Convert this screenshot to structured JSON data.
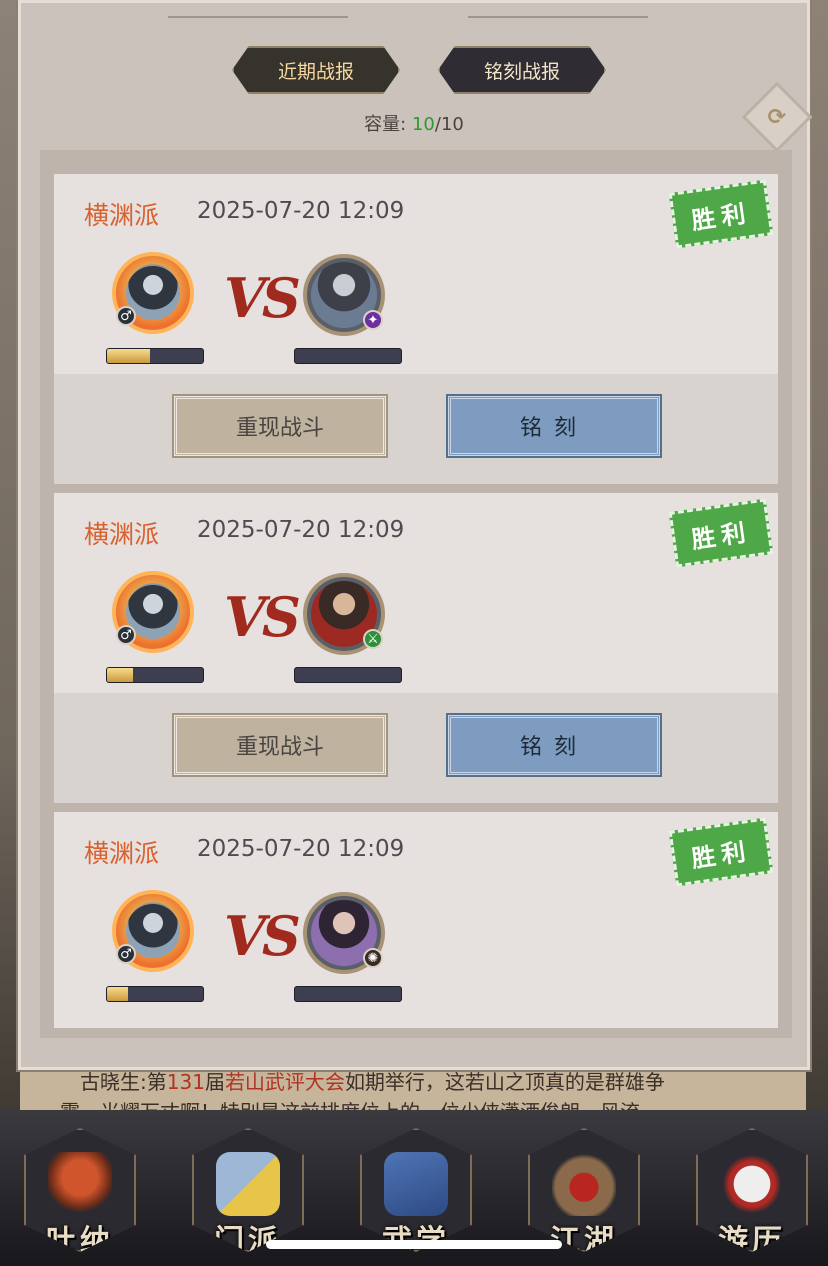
{
  "tabs": [
    {
      "label": "近期战报",
      "active": true
    },
    {
      "label": "铭刻战报",
      "active": false
    }
  ],
  "capacity": {
    "label": "容量:",
    "current": "10",
    "max": "/10"
  },
  "refresh_icon": "refresh-icon",
  "records": [
    {
      "sect": "横渊派",
      "time": "2025-07-20 12:09",
      "result": "胜利",
      "vs": "VS",
      "my_progress": 0.45,
      "replay_label": "重现战斗",
      "engrave_label": "铭刻"
    },
    {
      "sect": "横渊派",
      "time": "2025-07-20 12:09",
      "result": "胜利",
      "vs": "VS",
      "my_progress": 0.27,
      "replay_label": "重现战斗",
      "engrave_label": "铭刻"
    },
    {
      "sect": "横渊派",
      "time": "2025-07-20 12:09",
      "result": "胜利",
      "vs": "VS",
      "my_progress": 0.22
    }
  ],
  "chat": {
    "line1_a": "古晓生:第",
    "line1_b": "131",
    "line1_c": "届",
    "line1_d": "若山武评大会",
    "line1_e": "如期举行，这若山之顶真的是群雄争",
    "line2": "霸，光耀万丈啊！特别是这前排席位上的一位少侠潇洒俊朗，风流"
  },
  "nav": [
    {
      "label": "吐纳"
    },
    {
      "label": "门派"
    },
    {
      "label": "武学"
    },
    {
      "label": "江湖"
    },
    {
      "label": "游历"
    }
  ],
  "colors": {
    "sect": "#d9612f",
    "win_stamp": "#4fa847",
    "capacity_current": "#2d9a2d",
    "engrave_btn": "#7d9cc0"
  }
}
